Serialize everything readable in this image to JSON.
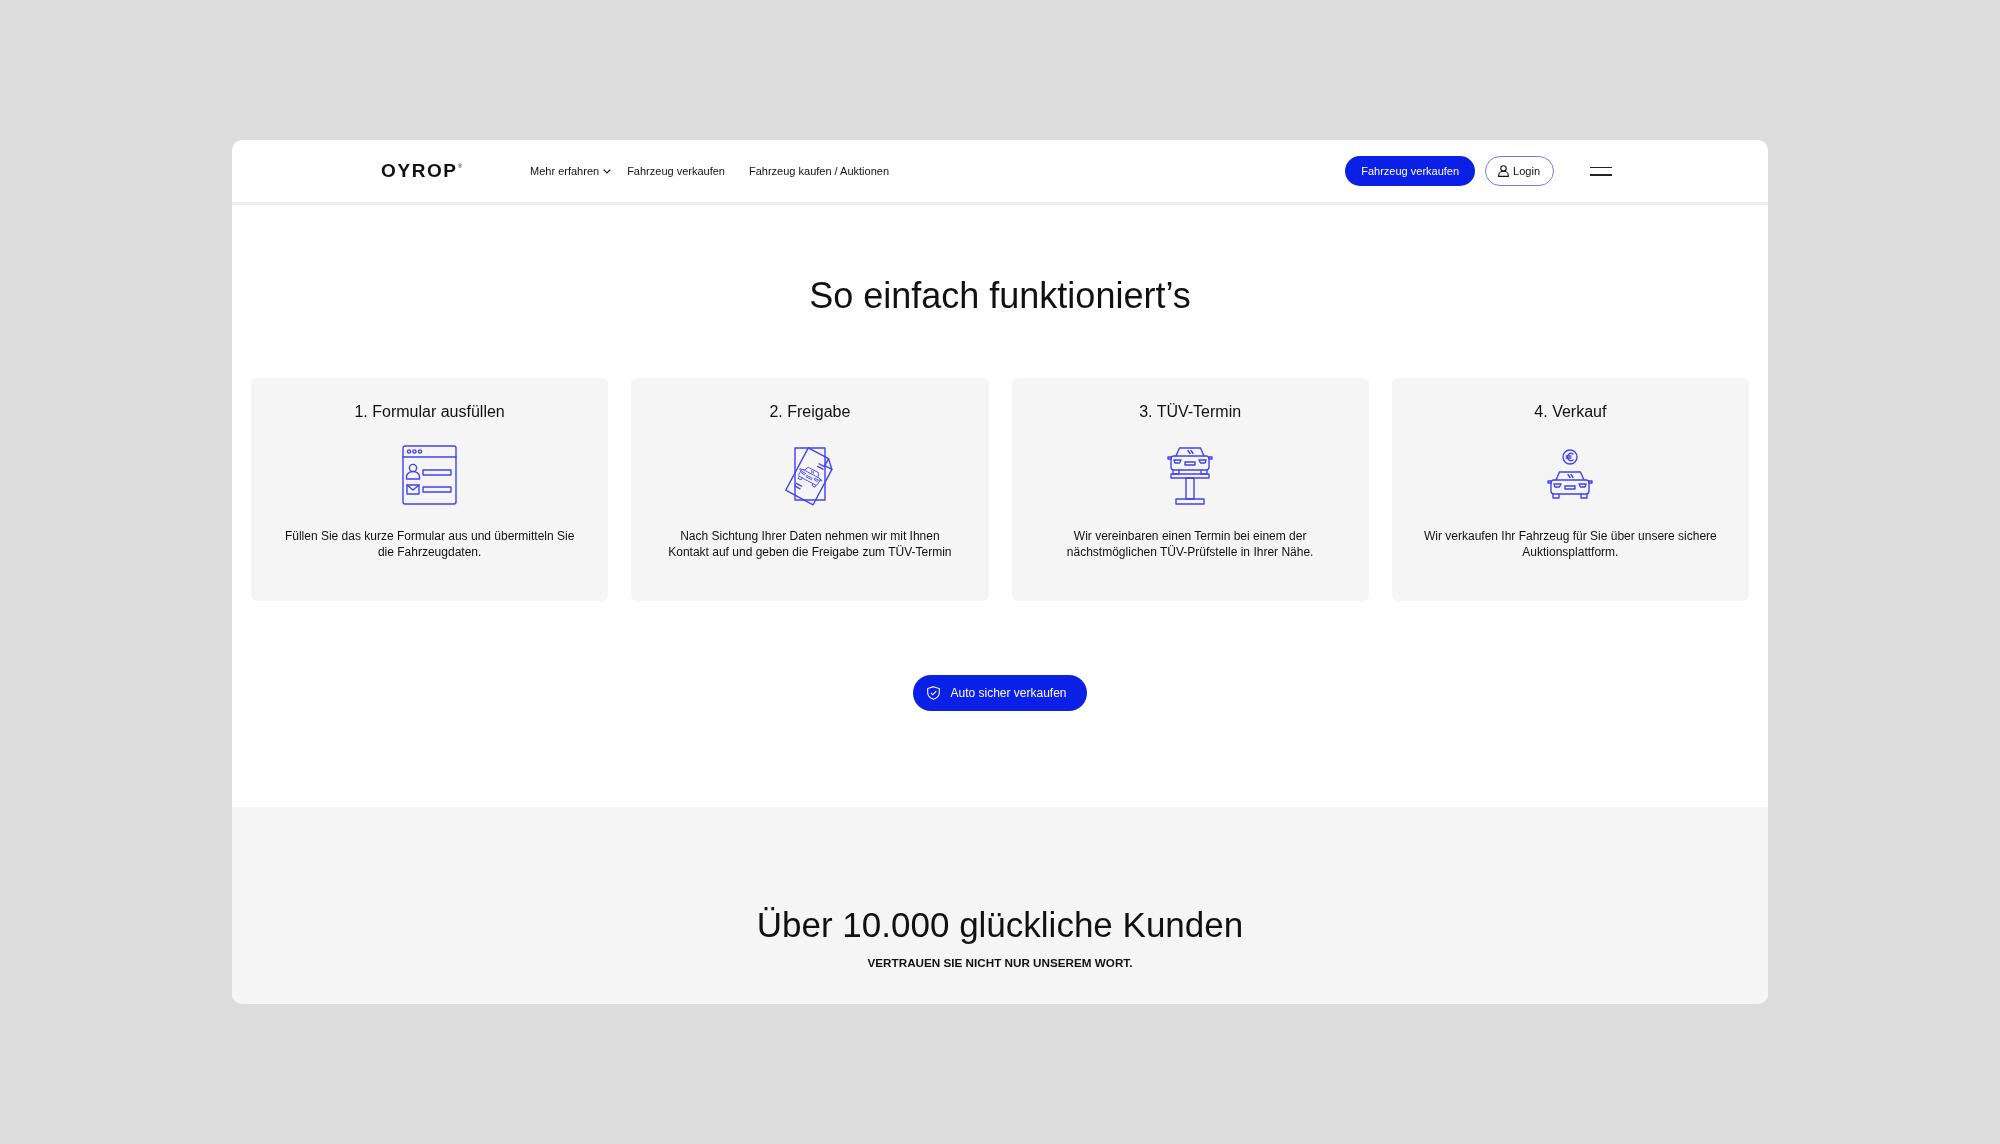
{
  "header": {
    "logo": "OYROP$^{®}$",
    "nav": [
      {
        "label": "Mehr erfahren",
        "dropdown": true
      },
      {
        "label": "Fahrzeug verkaufen",
        "dropdown": false
      },
      {
        "label": "Fahrzeug kaufen / Auktionen",
        "dropdown": false
      }
    ],
    "actions": [
      {
        "label": "Fahrzeug verkaufen",
        "kind": "primary"
      },
      {
        "label": "Login",
        "kind": "account"
      }
    ]
  },
  "how_it_works": {
    "title": "So einfach funktioniert’s",
    "steps": [
      {
        "title": "1. Formular ausfüllen",
        "text": "Füllen Sie das kurze Formular aus und übermitteln Sie die Fahrzeugdaten."
      },
      {
        "title": "2. Freigabe",
        "text": "Nach Sichtung Ihrer Daten nehmen wir mit Ihnen Kontakt auf und geben die Freigabe zum TÜV-Termin"
      },
      {
        "title": "3. TÜV-Termin",
        "text": "Wir vereinbaren einen Termin bei einem der nächstmöglichen TÜV-Prüfstelle in Ihrer Nähe."
      },
      {
        "title": "4. Verkauf",
        "text": "Wir verkaufen Ihr Fahrzeug für Sie über unsere sichere Auktionsplattform."
      }
    ],
    "cta": {
      "label": "Auto sicher verkaufen"
    }
  },
  "testimonials": {
    "title": "Über 10.000 glückliche Kunden",
    "subtitle": "VERTRAUEN SIE NICHT NUR UNSEREM WORT."
  }
}
